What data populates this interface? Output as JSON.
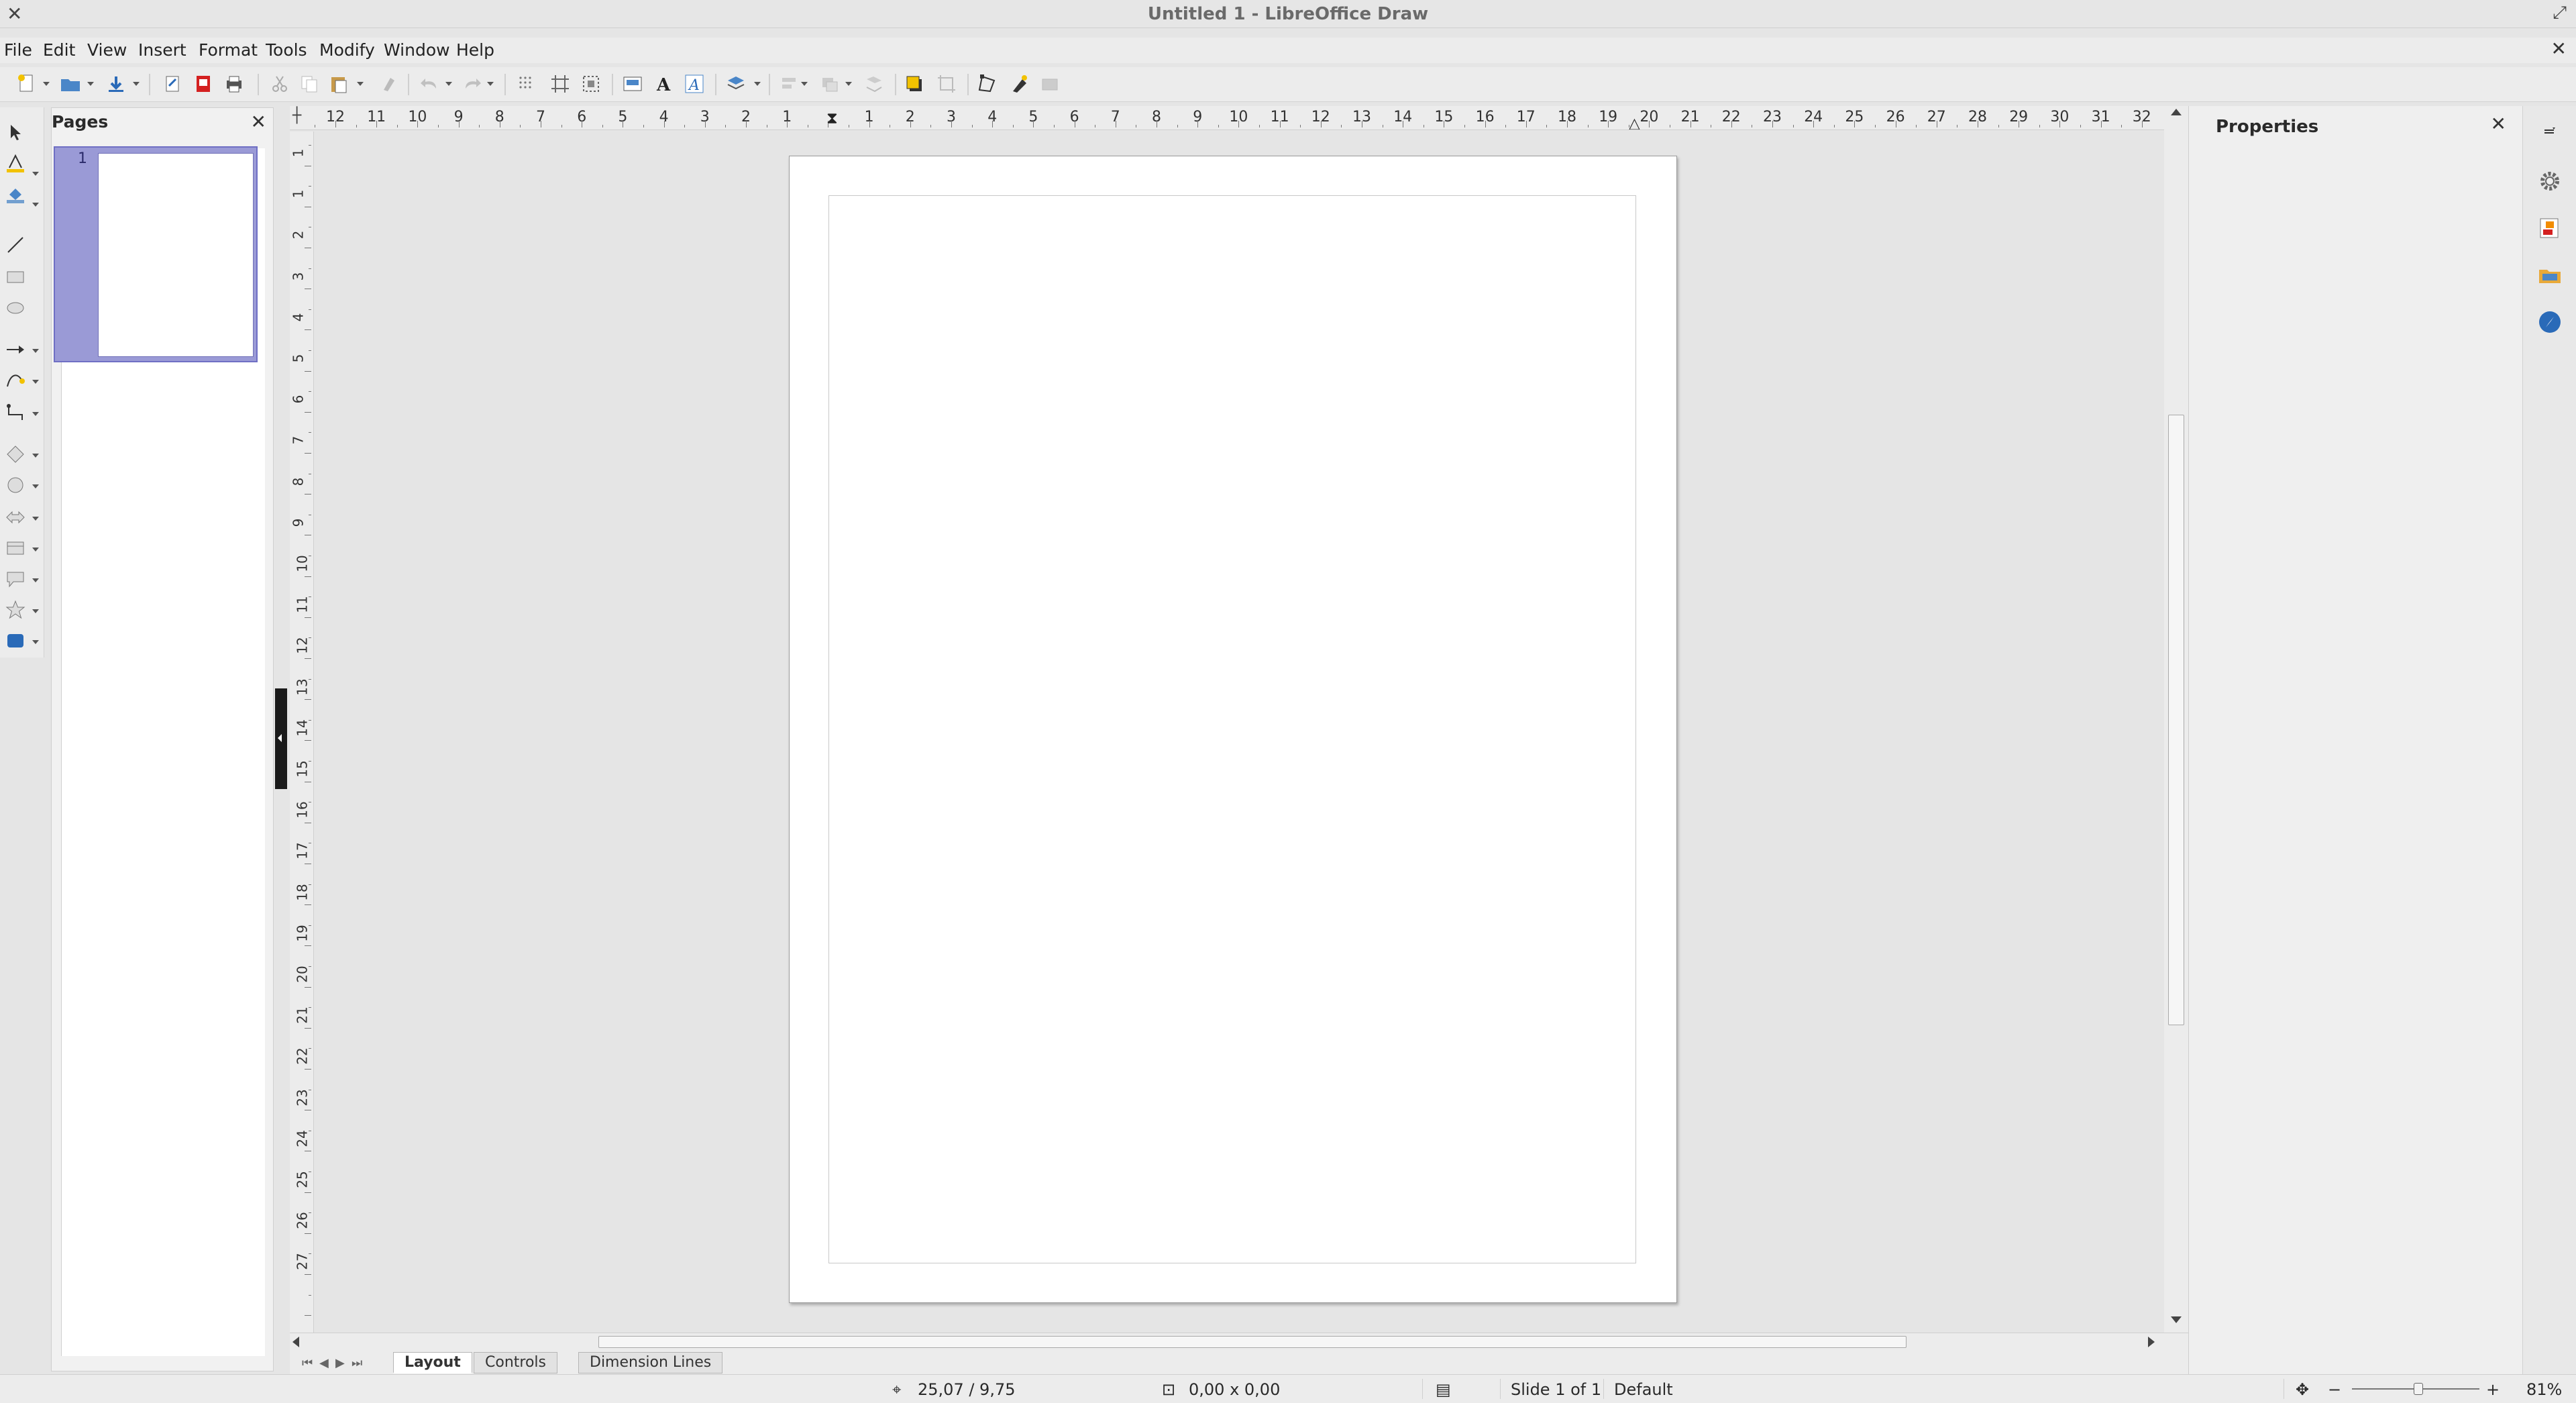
{
  "window": {
    "title": "Untitled 1 - LibreOffice Draw"
  },
  "menu": {
    "items": [
      "File",
      "Edit",
      "View",
      "Insert",
      "Format",
      "Tools",
      "Modify",
      "Window",
      "Help"
    ]
  },
  "pages_panel": {
    "title": "Pages",
    "pages": [
      {
        "number": "1"
      }
    ]
  },
  "rulers": {
    "horizontal": [
      "12",
      "11",
      "10",
      "9",
      "8",
      "7",
      "6",
      "5",
      "4",
      "3",
      "2",
      "1",
      "1",
      "2",
      "3",
      "4",
      "5",
      "6",
      "7",
      "8",
      "9",
      "10",
      "11",
      "12",
      "13",
      "14",
      "15",
      "16",
      "17",
      "18",
      "19",
      "20",
      "21",
      "22",
      "23",
      "24",
      "25",
      "26",
      "27",
      "28",
      "29",
      "30",
      "31",
      "32"
    ],
    "vertical": [
      "1",
      "1",
      "2",
      "3",
      "4",
      "5",
      "6",
      "7",
      "8",
      "9",
      "10",
      "11",
      "12",
      "13",
      "14",
      "15",
      "16",
      "17",
      "18",
      "19",
      "20",
      "21",
      "22",
      "23",
      "24",
      "25",
      "26",
      "27"
    ]
  },
  "tabs": [
    {
      "label": "Layout",
      "active": true
    },
    {
      "label": "Controls",
      "active": false
    },
    {
      "label": "Dimension Lines",
      "active": false
    }
  ],
  "properties": {
    "title": "Properties"
  },
  "status": {
    "position": "25,07 / 9,75",
    "size": "0,00 x 0,00",
    "slide": "Slide 1 of 1",
    "master": "Default",
    "zoom": "81%",
    "zoom_fraction": 0.52
  },
  "colors": {
    "selection": "#9a9ad6",
    "canvas": "#e5e5e5",
    "page": "#ffffff"
  },
  "icons": {
    "toolbar": [
      "new-document-icon",
      "open-icon",
      "save-icon",
      "export-icon",
      "export-pdf-icon",
      "print-icon",
      "cut-icon",
      "copy-icon",
      "paste-icon",
      "clone-formatting-icon",
      "undo-icon",
      "redo-icon",
      "grid-icon",
      "helplines-icon",
      "snap-icon",
      "image-icon",
      "fontwork-icon",
      "text-icon",
      "transform-icon",
      "align-icon",
      "arrange-icon",
      "shadow-icon",
      "crop-icon",
      "points-icon",
      "glue-icon",
      "extrusion-icon"
    ],
    "left": [
      "select-icon",
      "line-color-icon",
      "fill-color-icon",
      "line-tool-icon",
      "rectangle-tool-icon",
      "ellipse-tool-icon",
      "arrow-line-icon",
      "curve-icon",
      "connector-icon",
      "basic-shapes-icon",
      "symbol-shapes-icon",
      "block-arrows-icon",
      "flowchart-icon",
      "callouts-icon",
      "stars-icon",
      "3d-objects-icon"
    ],
    "sidebar": [
      "sidebar-menu-icon",
      "properties-gear-icon",
      "styles-icon",
      "gallery-icon",
      "navigator-icon"
    ]
  }
}
